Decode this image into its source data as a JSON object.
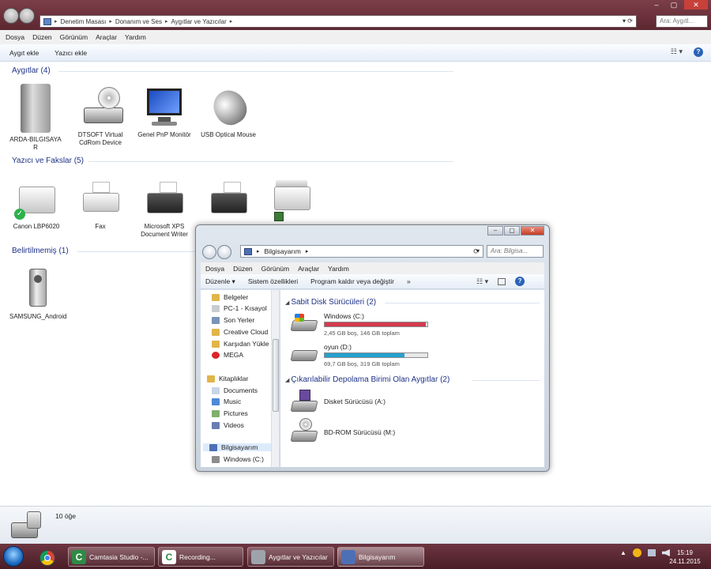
{
  "window": {
    "breadcrumb": [
      "Denetim Masası",
      "Donanım ve Ses",
      "Aygıtlar ve Yazıcılar"
    ],
    "search_placeholder": "Ara: Aygıtl...",
    "controls": {
      "minimize": "–",
      "maximize": "▢",
      "close": "✕"
    },
    "nav_dropdown": "▾",
    "refresh": "⟳"
  },
  "menu": [
    "Dosya",
    "Düzen",
    "Görünüm",
    "Araçlar",
    "Yardım"
  ],
  "commands": {
    "add_device": "Aygıt ekle",
    "add_printer": "Yazıcı ekle",
    "view": "☷ ▾",
    "help": "?"
  },
  "groups": {
    "devices": {
      "title": "Aygıtlar (4)",
      "items": [
        "ARDA-BILGISAYA R",
        "DTSOFT Virtual CdRom Device",
        "Genel PnP Monitör",
        "USB Optical Mouse"
      ]
    },
    "printers": {
      "title": "Yazıcı ve Fakslar (5)",
      "items": [
        "Canon LBP6020",
        "Fax",
        "Microsoft XPS Document Writer",
        "",
        ""
      ]
    },
    "unspecified": {
      "title": "Belirtilmemiş (1)",
      "items": [
        "SAMSUNG_Android"
      ]
    }
  },
  "status": {
    "count": "10 öğe"
  },
  "taskbar": {
    "tasks": [
      {
        "label": "Camtasia Studio -...",
        "icon": "C",
        "color": "#2e8b45"
      },
      {
        "label": "Recording...",
        "icon": "C",
        "color": "#2e8b45"
      },
      {
        "label": "Aygıtlar ve Yazıcılar",
        "icon": "",
        "color": "#8a8f99"
      },
      {
        "label": "Bilgisayarım",
        "icon": "",
        "color": "#4d6fb5"
      }
    ],
    "tray": "▲",
    "time": "15:19",
    "date": "24.11.2015"
  },
  "computer_window": {
    "address": "Bilgisayarım",
    "search_placeholder": "Ara: Bilgisa...",
    "menu": [
      "Dosya",
      "Düzen",
      "Görünüm",
      "Araçlar",
      "Yardım"
    ],
    "commands": [
      "Düzenle ▾",
      "Sistem özellikleri",
      "Program kaldır veya değiştir",
      "»"
    ],
    "nav": [
      {
        "label": "Belgeler",
        "color": "#e0b54a"
      },
      {
        "label": "PC-1 - Kısayol",
        "color": "#c8ccd2"
      },
      {
        "label": "Son Yerler",
        "color": "#7a93b8"
      },
      {
        "label": "Creative Cloud",
        "color": "#e0b54a"
      },
      {
        "label": "Karşıdan Yükle",
        "color": "#e0b54a"
      },
      {
        "label": "MEGA",
        "color": "#d9252b"
      },
      {
        "label": "Kitaplıklar",
        "color": "#e0b54a"
      },
      {
        "label": "Documents",
        "color": "#c8d5e8"
      },
      {
        "label": "Music",
        "color": "#4d8ad6"
      },
      {
        "label": "Pictures",
        "color": "#7fb06c"
      },
      {
        "label": "Videos",
        "color": "#6a7fb0"
      },
      {
        "label": "Bilgisayarım",
        "color": "#4d6fb5"
      },
      {
        "label": "Windows (C:)",
        "color": "#8c8c8c"
      }
    ],
    "hard_drives_title": "Sabit Disk Sürücüleri (2)",
    "drives": [
      {
        "name": "Windows (C:)",
        "info": "2,45 GB boş, 146 GB toplam",
        "used_fraction": 0.983,
        "color": "#d43a4f"
      },
      {
        "name": "oyun (D:)",
        "info": "69,7 GB boş, 319 GB toplam",
        "used_fraction": 0.78,
        "color": "#26a0d0"
      }
    ],
    "removable_title": "Çıkarılabilir Depolama Birimi Olan Aygıtlar (2)",
    "removable": [
      {
        "name": "Disket Sürücüsü (A:)"
      },
      {
        "name": "BD-ROM Sürücüsü (M:)"
      }
    ]
  }
}
